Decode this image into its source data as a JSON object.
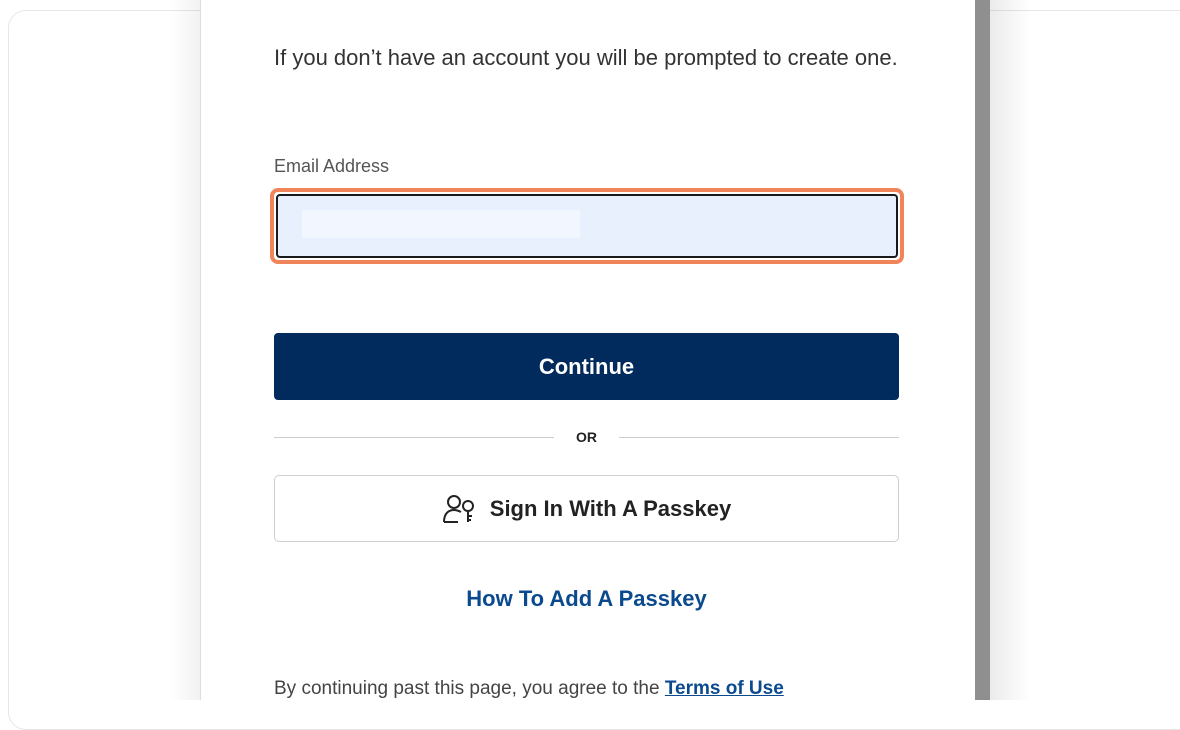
{
  "intro_text": "If you don’t have an account you will be prompted to create one.",
  "email": {
    "label": "Email Address",
    "value": ""
  },
  "continue_label": "Continue",
  "divider_label": "OR",
  "passkey_button_label": "Sign In With A Passkey",
  "how_to_link_label": "How To Add A Passkey",
  "legal": {
    "prefix": "By continuing past this page, you agree to the",
    "terms_link": "Terms of Use"
  },
  "colors": {
    "primary": "#002b5c",
    "link": "#0b4a8f",
    "focus_ring": "#f0845a",
    "input_fill": "#e8f0fe"
  },
  "icons": {
    "passkey": "person-key-icon"
  }
}
